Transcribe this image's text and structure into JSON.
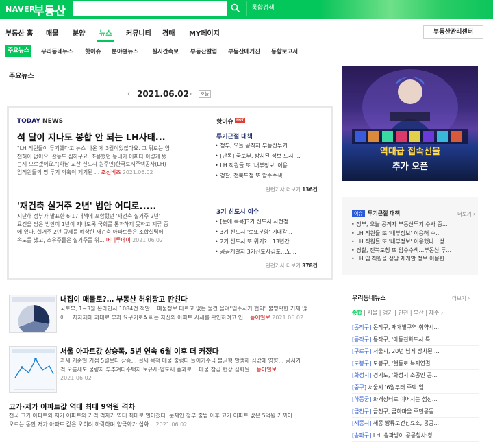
{
  "header": {
    "naver_logo": "NAVER",
    "service_name": "부동산",
    "search_placeholder": "",
    "integrated_search_label": "통합검색",
    "colors": {
      "brand": "#03c75a"
    }
  },
  "gnb": {
    "items": [
      "부동산 홈",
      "매물",
      "분양",
      "뉴스",
      "커뮤니티",
      "경매",
      "MY페이지"
    ],
    "active": "뉴스",
    "agency_button": "부동산관리센터"
  },
  "lnb": {
    "items": [
      "주요뉴스",
      "우리동네뉴스",
      "핫이슈",
      "분야별뉴스",
      "실시간속보",
      "부동산칼럼",
      "부동산매거진",
      "동향보고서"
    ],
    "active": "주요뉴스"
  },
  "main": {
    "section_title": "주요뉴스",
    "date": "2021.06.02",
    "today_label": "오늘",
    "today_logo": {
      "today": "TODAY",
      "news": "NEWS"
    },
    "top_articles": [
      {
        "headline": "석 달이 지나도 봉합 안 되는 LH사태...",
        "summary_lines": [
          "\"LH 직원들이 투기했다고 뉴스 나온 게 3월이었잖아요. 그 뒤로는 영",
          "전혀이 없어요. 갈등도 심하구요. 조용했던 동네가 어쩌다 이렇게 됐",
          "는지 모르겠어요.\"(하남 교산 신도시 원주민)한국토지주택공사(LH)",
          "임직원들의 땅 투기 의혹이 제기된 ..."
        ],
        "source": "조선비즈",
        "date": "2021.06.02"
      },
      {
        "headline": "'재건축 실거주 2년' 법안 어디로.....",
        "summary_lines": [
          "지난해 정부가 발표한 6·17대책에 포함됐던 '재건축 실거주 2년'",
          "요건을 담은 법안이 1년이 지나도록 국회를 통과하지 못하고 계류 중",
          "에 있다. 실거주 2년 규제를 예상한 재건축 아파트들은 조합설립에",
          "속도를 냈고, 소유주들은 실거주를 위..."
        ],
        "source": "머니투데이",
        "date": "2021.06.02"
      }
    ],
    "hot_issue": {
      "label": "핫이슈",
      "badge": "HOT",
      "topics": [
        {
          "title": "투기근절 대책",
          "items": [
            "정부, 오늘 공직자 부동산투기 ...",
            "[단독] 국토부, 방치된 정보 도시 ...",
            "LH 직원들 또 '내부정보' 이용...",
            "경찰, 전북도청 또 압수수색 ..."
          ],
          "more_prefix": "관련기사 더보기",
          "count": "136건"
        },
        {
          "title": "3기 신도시 이슈",
          "items": [
            "[눈에 콕콕]3기 신도시 사전청...",
            "3기 신도시 '로또분양' 기대감...",
            "2기 신도시 또 위기?…13년간 ...",
            "공공개발지 3기신도시김포…노..."
          ],
          "more_prefix": "관련기사 더보기",
          "count": "378건"
        }
      ]
    },
    "news_list": [
      {
        "title": "내집이 매물로?… 부동산 허위광고 판친다",
        "body_lines": [
          "국토부, 1~3월 온라인서 1084건 적발… 매물정보 다르고 없는 물건 올려\"입주시기 협의\" 불명확한 기재 많",
          "아… 지자체에 과태료 부과 요구키로A 씨는 자신의 아파트 시세를 확인하려고 인..."
        ],
        "source": "동아일보",
        "date": "2021.06.02"
      },
      {
        "title": "서울 아파트값 상승폭, 5년 연속 6월 이후 더 커졌다",
        "body_lines": [
          "과세 기준일 기점 5월보다 상승… 절세 목적 매물 출렁다 들어가수급 불균형 발생해 집값에 영향… 공시가",
          "격 오름세도 물량차 부추겨다주택자 보유세·양도세 중과로… 매물 잠김 현상 심화될..."
        ],
        "source": "동아일보",
        "date": "2021.06.02"
      },
      {
        "title": "고가·저가 아파트값 역대 최대 9억원 격차",
        "body_lines": [
          "전국 고가 아파트와 저가 아파트의 가격 격차가 역대 최대로 벌어졌다. 문재인 정부 출범 이후 고가 아파트 값은 5억원 가까이",
          "오르는 동안 저가 아파트 값은 오히려 하락하며 양극화가 심화..."
        ],
        "source": "",
        "date": "2021.06.02"
      }
    ]
  },
  "ad": {
    "line1": "역대급 접속선물",
    "line2": "추가 오픈"
  },
  "side_topic": {
    "badge": "이슈",
    "title": "투기근절 대책",
    "more": "더보기",
    "items": [
      "정부, 오늘 공직자 부동산투기 수사 중...",
      "LH 직원들 또 '내부정보' 이용해 수...",
      "LH 직원들 또 '내부정보' 이용했나…성...",
      "경찰, 전북도청 또 압수수색…부동산 투...",
      "LH 임 직원을 성남 재개발 정보 이용한..."
    ]
  },
  "local_news": {
    "title": "우리동네뉴스",
    "more": "더보기",
    "tabs": [
      "종합",
      "서울",
      "경기",
      "인천",
      "부산",
      "제주"
    ],
    "active_tab": "종합",
    "items": [
      {
        "region": "[동작구]",
        "text": "동작구, 재개발구역 취약시..."
      },
      {
        "region": "[동작구]",
        "text": "동작구, '아동친화도시 특..."
      },
      {
        "region": "[구로구]",
        "text": "서울시, 20년 넘게 방치된 ..."
      },
      {
        "region": "[도봉구]",
        "text": "도봉구, '햇동로 녹지연결..."
      },
      {
        "region": "[화성시]",
        "text": "경기도, '화성시 소공인 공..."
      },
      {
        "region": "[중구]",
        "text": "서울시 '6월부터 주택 임..."
      },
      {
        "region": "[하동군]",
        "text": "화개장터로 이어지는 섬진..."
      },
      {
        "region": "[금천구]",
        "text": "금천구, 금하마을 주민공동..."
      },
      {
        "region": "[세종시]",
        "text": "세종 쌍류보건진료소, 공공..."
      },
      {
        "region": "[송파구]",
        "text": "LH, 송파방이 공공청사·창..."
      }
    ]
  }
}
